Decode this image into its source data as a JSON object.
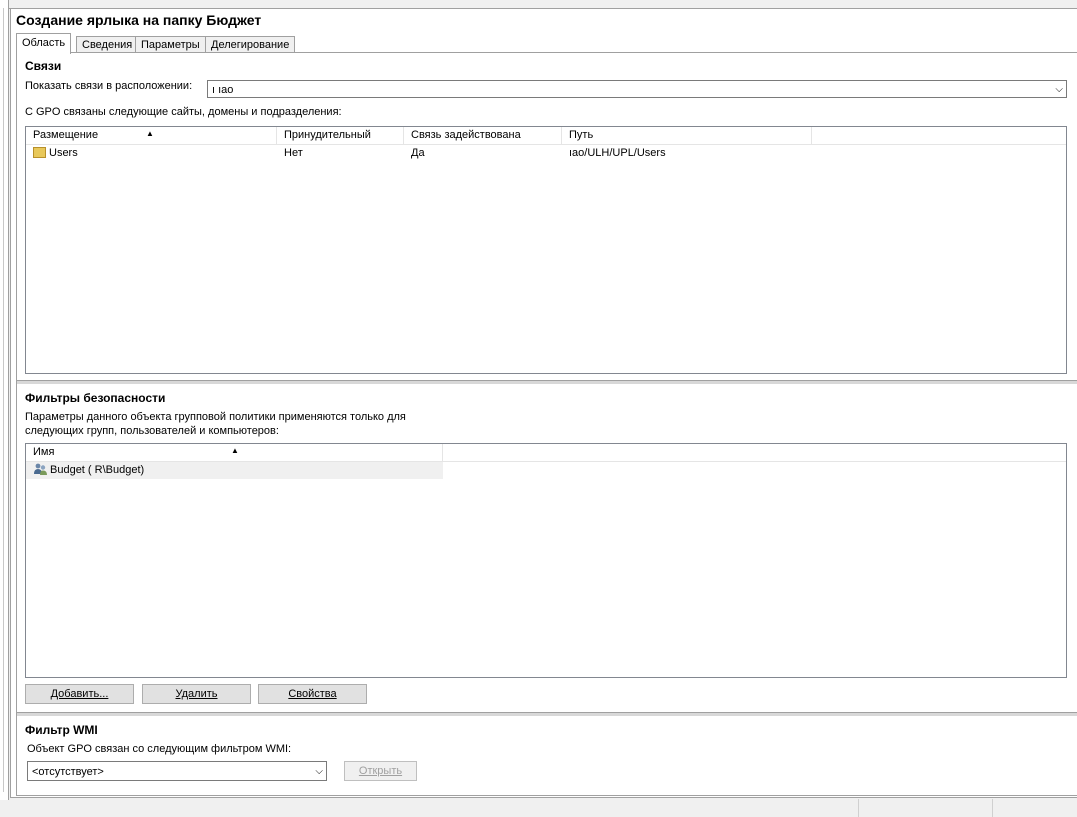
{
  "window": {
    "title": "Создание ярлыка на папку Бюджет"
  },
  "tabs": [
    {
      "label": "Область",
      "active": true
    },
    {
      "label": "Сведения",
      "active": false
    },
    {
      "label": "Параметры",
      "active": false
    },
    {
      "label": "Делегирование",
      "active": false
    }
  ],
  "links": {
    "section_title": "Связи",
    "location_label": "Показать связи в расположении:",
    "location_value": "ı                 ıao",
    "description": "С GPO связаны следующие сайты, домены и подразделения:",
    "columns": [
      "Размещение",
      "Принудительный",
      "Связь задействована",
      "Путь"
    ],
    "rows": [
      {
        "location": "Users",
        "enforced": "Нет",
        "enabled": "Да",
        "path": "             ıao/ULH/UPL/Users",
        "icon": "folder-icon"
      }
    ]
  },
  "security": {
    "section_title": "Фильтры безопасности",
    "description_line1": "Параметры данного объекта групповой политики применяются только для",
    "description_line2": "следующих групп, пользователей и компьютеров:",
    "column": "Имя",
    "rows": [
      {
        "name": "Budget (                          R\\Budget)",
        "icon": "users-group-icon"
      }
    ],
    "buttons": {
      "add": "Добавить...",
      "remove": "Удалить",
      "properties": "Свойства"
    }
  },
  "wmi": {
    "section_title": "Фильтр WMI",
    "description": "Объект GPO связан со следующим фильтром WMI:",
    "filter_value": "<отсутствует>",
    "open_button": "Открыть"
  }
}
